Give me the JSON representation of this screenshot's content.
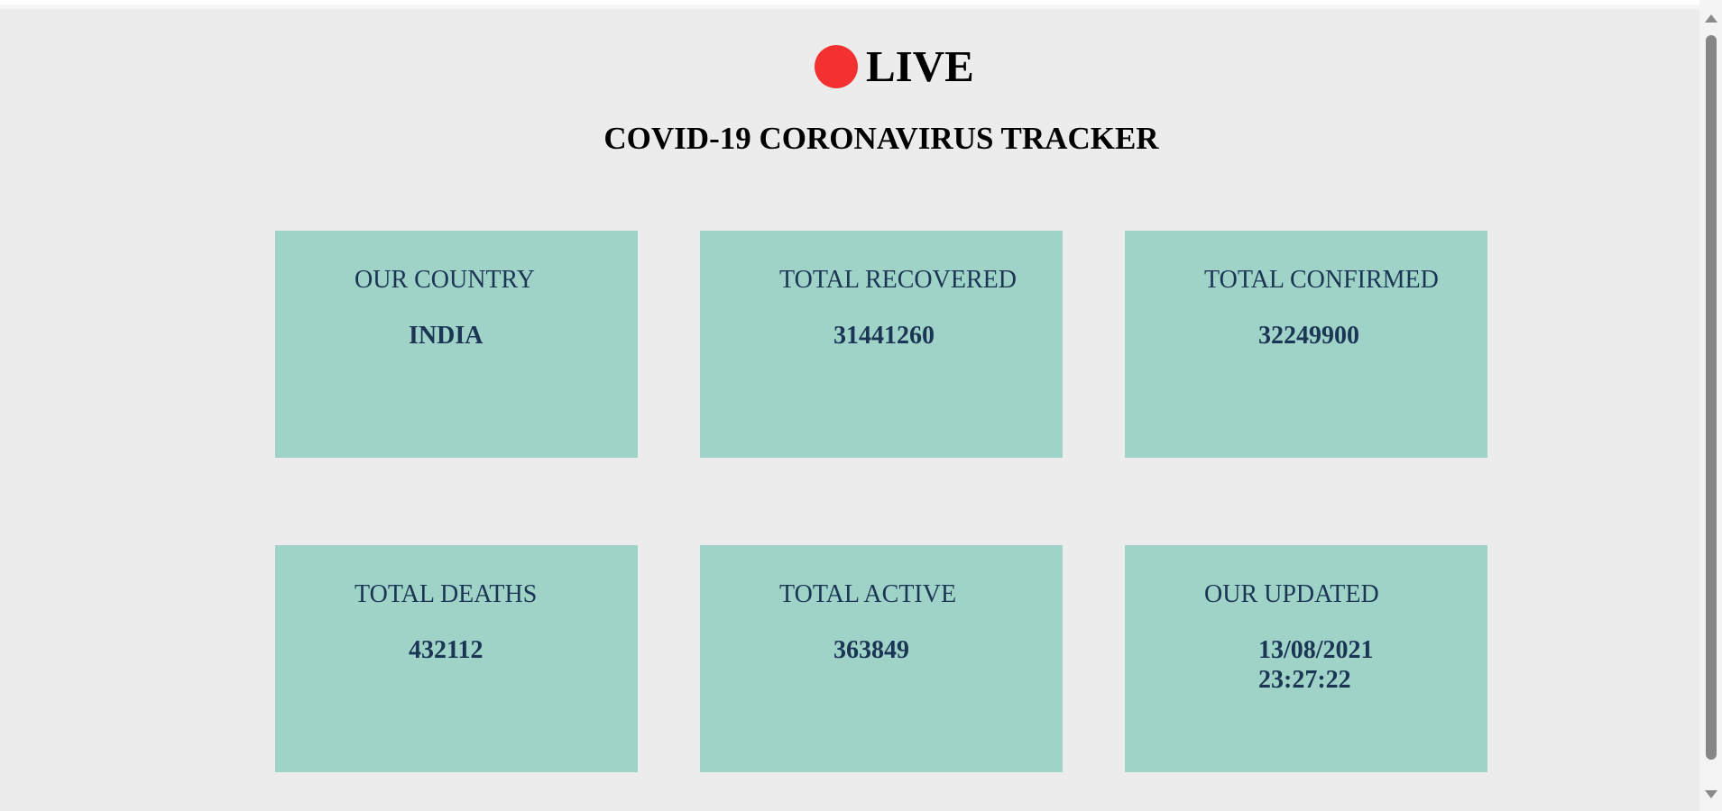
{
  "header": {
    "live_label": "LIVE",
    "title": "COVID-19 CORONAVIRUS TRACKER",
    "live_dot_color": "#f33131"
  },
  "cards": [
    {
      "label": "OUR COUNTRY",
      "value": "INDIA"
    },
    {
      "label": "TOTAL RECOVERED",
      "value": "31441260"
    },
    {
      "label": "TOTAL CONFIRMED",
      "value": "32249900"
    },
    {
      "label": "TOTAL DEATHS",
      "value": "432112"
    },
    {
      "label": "TOTAL ACTIVE",
      "value": "363849"
    },
    {
      "label": "OUR UPDATED",
      "value_date": "13/08/2021",
      "value_time": "23:27:22"
    }
  ],
  "colors": {
    "card_background": "#a0d3c8",
    "card_text": "#1b3655",
    "page_background": "#ececec"
  }
}
